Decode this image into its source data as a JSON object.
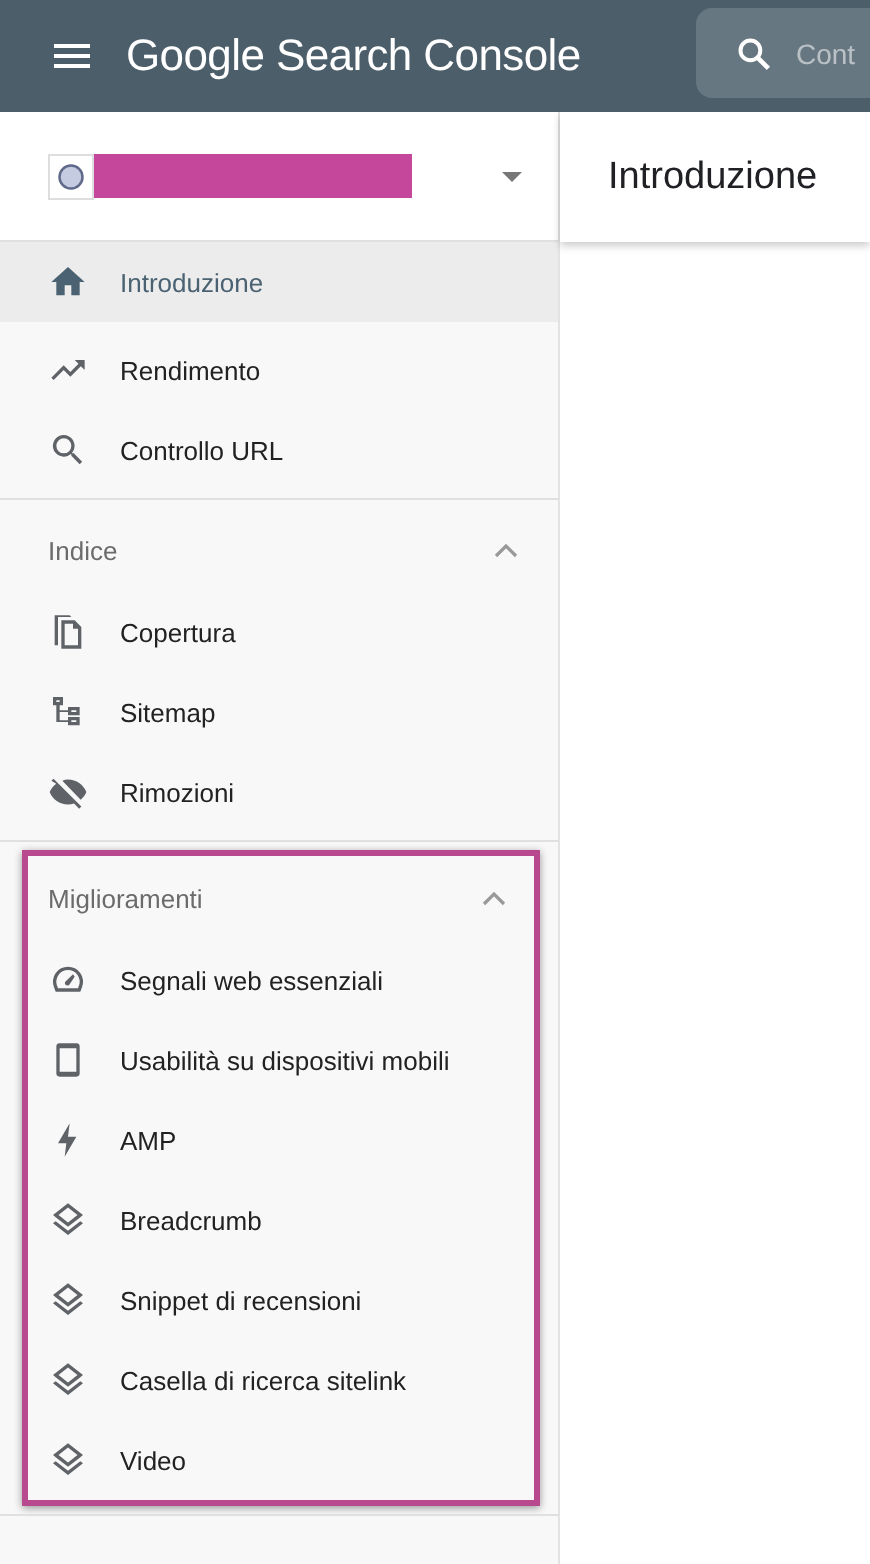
{
  "top_bar": {
    "logo": "Google Search Console",
    "search": {
      "placeholder": "Cont"
    }
  },
  "property_selector": {
    "name_redacted": true
  },
  "page_title": "Introduzione",
  "sidebar": {
    "sections": [
      {
        "items": [
          {
            "label": "Introduzione",
            "selected": true
          },
          {
            "label": "Rendimento",
            "selected": false
          },
          {
            "label": "Controllo URL",
            "selected": false
          }
        ]
      },
      {
        "title": "Indice",
        "expanded": true,
        "highlighted": false,
        "items": [
          {
            "label": "Copertura",
            "selected": false
          },
          {
            "label": "Sitemap",
            "selected": false
          },
          {
            "label": "Rimozioni",
            "selected": false
          }
        ]
      },
      {
        "title": "Miglioramenti",
        "expanded": true,
        "highlighted": true,
        "items": [
          {
            "label": "Segnali web essenziali",
            "selected": false
          },
          {
            "label": "Usabilità su dispositivi mobili",
            "selected": false
          },
          {
            "label": "AMP",
            "selected": false
          },
          {
            "label": "Breadcrumb",
            "selected": false
          },
          {
            "label": "Snippet di recensioni",
            "selected": false
          },
          {
            "label": "Casella di ricerca sitelink",
            "selected": false
          },
          {
            "label": "Video",
            "selected": false
          }
        ]
      }
    ]
  }
}
